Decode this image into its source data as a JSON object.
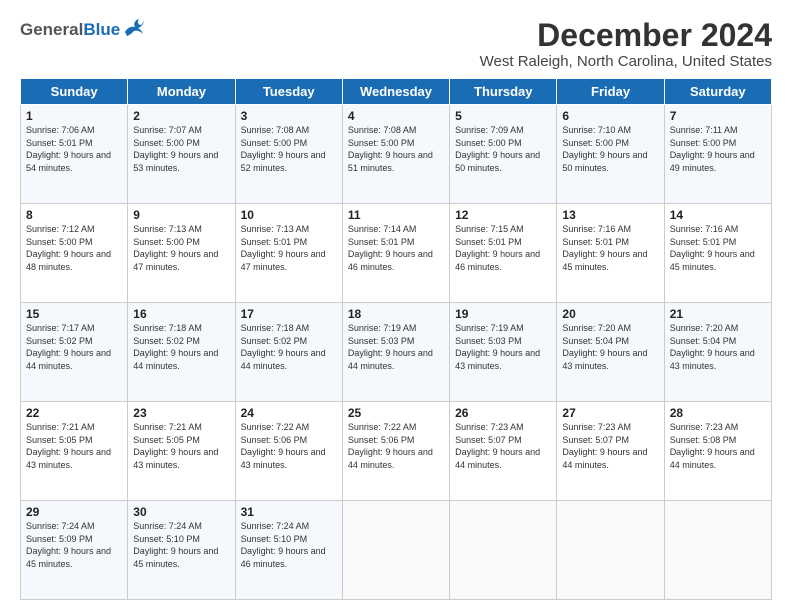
{
  "header": {
    "logo_general": "General",
    "logo_blue": "Blue",
    "title": "December 2024",
    "subtitle": "West Raleigh, North Carolina, United States"
  },
  "days_of_week": [
    "Sunday",
    "Monday",
    "Tuesday",
    "Wednesday",
    "Thursday",
    "Friday",
    "Saturday"
  ],
  "weeks": [
    [
      {
        "day": "1",
        "sunrise": "Sunrise: 7:06 AM",
        "sunset": "Sunset: 5:01 PM",
        "daylight": "Daylight: 9 hours and 54 minutes."
      },
      {
        "day": "2",
        "sunrise": "Sunrise: 7:07 AM",
        "sunset": "Sunset: 5:00 PM",
        "daylight": "Daylight: 9 hours and 53 minutes."
      },
      {
        "day": "3",
        "sunrise": "Sunrise: 7:08 AM",
        "sunset": "Sunset: 5:00 PM",
        "daylight": "Daylight: 9 hours and 52 minutes."
      },
      {
        "day": "4",
        "sunrise": "Sunrise: 7:08 AM",
        "sunset": "Sunset: 5:00 PM",
        "daylight": "Daylight: 9 hours and 51 minutes."
      },
      {
        "day": "5",
        "sunrise": "Sunrise: 7:09 AM",
        "sunset": "Sunset: 5:00 PM",
        "daylight": "Daylight: 9 hours and 50 minutes."
      },
      {
        "day": "6",
        "sunrise": "Sunrise: 7:10 AM",
        "sunset": "Sunset: 5:00 PM",
        "daylight": "Daylight: 9 hours and 50 minutes."
      },
      {
        "day": "7",
        "sunrise": "Sunrise: 7:11 AM",
        "sunset": "Sunset: 5:00 PM",
        "daylight": "Daylight: 9 hours and 49 minutes."
      }
    ],
    [
      {
        "day": "8",
        "sunrise": "Sunrise: 7:12 AM",
        "sunset": "Sunset: 5:00 PM",
        "daylight": "Daylight: 9 hours and 48 minutes."
      },
      {
        "day": "9",
        "sunrise": "Sunrise: 7:13 AM",
        "sunset": "Sunset: 5:00 PM",
        "daylight": "Daylight: 9 hours and 47 minutes."
      },
      {
        "day": "10",
        "sunrise": "Sunrise: 7:13 AM",
        "sunset": "Sunset: 5:01 PM",
        "daylight": "Daylight: 9 hours and 47 minutes."
      },
      {
        "day": "11",
        "sunrise": "Sunrise: 7:14 AM",
        "sunset": "Sunset: 5:01 PM",
        "daylight": "Daylight: 9 hours and 46 minutes."
      },
      {
        "day": "12",
        "sunrise": "Sunrise: 7:15 AM",
        "sunset": "Sunset: 5:01 PM",
        "daylight": "Daylight: 9 hours and 46 minutes."
      },
      {
        "day": "13",
        "sunrise": "Sunrise: 7:16 AM",
        "sunset": "Sunset: 5:01 PM",
        "daylight": "Daylight: 9 hours and 45 minutes."
      },
      {
        "day": "14",
        "sunrise": "Sunrise: 7:16 AM",
        "sunset": "Sunset: 5:01 PM",
        "daylight": "Daylight: 9 hours and 45 minutes."
      }
    ],
    [
      {
        "day": "15",
        "sunrise": "Sunrise: 7:17 AM",
        "sunset": "Sunset: 5:02 PM",
        "daylight": "Daylight: 9 hours and 44 minutes."
      },
      {
        "day": "16",
        "sunrise": "Sunrise: 7:18 AM",
        "sunset": "Sunset: 5:02 PM",
        "daylight": "Daylight: 9 hours and 44 minutes."
      },
      {
        "day": "17",
        "sunrise": "Sunrise: 7:18 AM",
        "sunset": "Sunset: 5:02 PM",
        "daylight": "Daylight: 9 hours and 44 minutes."
      },
      {
        "day": "18",
        "sunrise": "Sunrise: 7:19 AM",
        "sunset": "Sunset: 5:03 PM",
        "daylight": "Daylight: 9 hours and 44 minutes."
      },
      {
        "day": "19",
        "sunrise": "Sunrise: 7:19 AM",
        "sunset": "Sunset: 5:03 PM",
        "daylight": "Daylight: 9 hours and 43 minutes."
      },
      {
        "day": "20",
        "sunrise": "Sunrise: 7:20 AM",
        "sunset": "Sunset: 5:04 PM",
        "daylight": "Daylight: 9 hours and 43 minutes."
      },
      {
        "day": "21",
        "sunrise": "Sunrise: 7:20 AM",
        "sunset": "Sunset: 5:04 PM",
        "daylight": "Daylight: 9 hours and 43 minutes."
      }
    ],
    [
      {
        "day": "22",
        "sunrise": "Sunrise: 7:21 AM",
        "sunset": "Sunset: 5:05 PM",
        "daylight": "Daylight: 9 hours and 43 minutes."
      },
      {
        "day": "23",
        "sunrise": "Sunrise: 7:21 AM",
        "sunset": "Sunset: 5:05 PM",
        "daylight": "Daylight: 9 hours and 43 minutes."
      },
      {
        "day": "24",
        "sunrise": "Sunrise: 7:22 AM",
        "sunset": "Sunset: 5:06 PM",
        "daylight": "Daylight: 9 hours and 43 minutes."
      },
      {
        "day": "25",
        "sunrise": "Sunrise: 7:22 AM",
        "sunset": "Sunset: 5:06 PM",
        "daylight": "Daylight: 9 hours and 44 minutes."
      },
      {
        "day": "26",
        "sunrise": "Sunrise: 7:23 AM",
        "sunset": "Sunset: 5:07 PM",
        "daylight": "Daylight: 9 hours and 44 minutes."
      },
      {
        "day": "27",
        "sunrise": "Sunrise: 7:23 AM",
        "sunset": "Sunset: 5:07 PM",
        "daylight": "Daylight: 9 hours and 44 minutes."
      },
      {
        "day": "28",
        "sunrise": "Sunrise: 7:23 AM",
        "sunset": "Sunset: 5:08 PM",
        "daylight": "Daylight: 9 hours and 44 minutes."
      }
    ],
    [
      {
        "day": "29",
        "sunrise": "Sunrise: 7:24 AM",
        "sunset": "Sunset: 5:09 PM",
        "daylight": "Daylight: 9 hours and 45 minutes."
      },
      {
        "day": "30",
        "sunrise": "Sunrise: 7:24 AM",
        "sunset": "Sunset: 5:10 PM",
        "daylight": "Daylight: 9 hours and 45 minutes."
      },
      {
        "day": "31",
        "sunrise": "Sunrise: 7:24 AM",
        "sunset": "Sunset: 5:10 PM",
        "daylight": "Daylight: 9 hours and 46 minutes."
      },
      null,
      null,
      null,
      null
    ]
  ]
}
